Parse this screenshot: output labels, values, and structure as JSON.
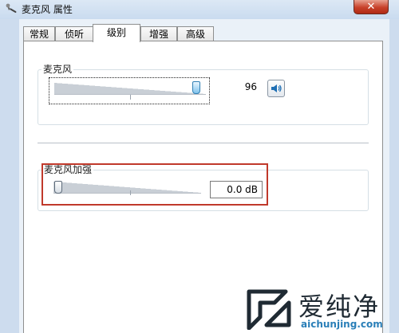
{
  "window": {
    "title": "麦克风 属性",
    "close_symbol": "✕"
  },
  "tabs": [
    {
      "label": "常规",
      "active": false
    },
    {
      "label": "侦听",
      "active": false
    },
    {
      "label": "级别",
      "active": true
    },
    {
      "label": "增强",
      "active": false
    },
    {
      "label": "高级",
      "active": false
    }
  ],
  "microphone": {
    "label": "麦克风",
    "level": 96,
    "level_text": "96",
    "speaker_icon": "speaker-icon"
  },
  "boost": {
    "label": "麦克风加强",
    "value": "0.0 dB",
    "level_fraction": 0
  },
  "watermark": {
    "text": "爱纯净",
    "url": "aichunjing.com"
  },
  "colors": {
    "highlight": "#c0392b",
    "accent_blue": "#2f7fb3",
    "close_red": "#c8412a"
  }
}
